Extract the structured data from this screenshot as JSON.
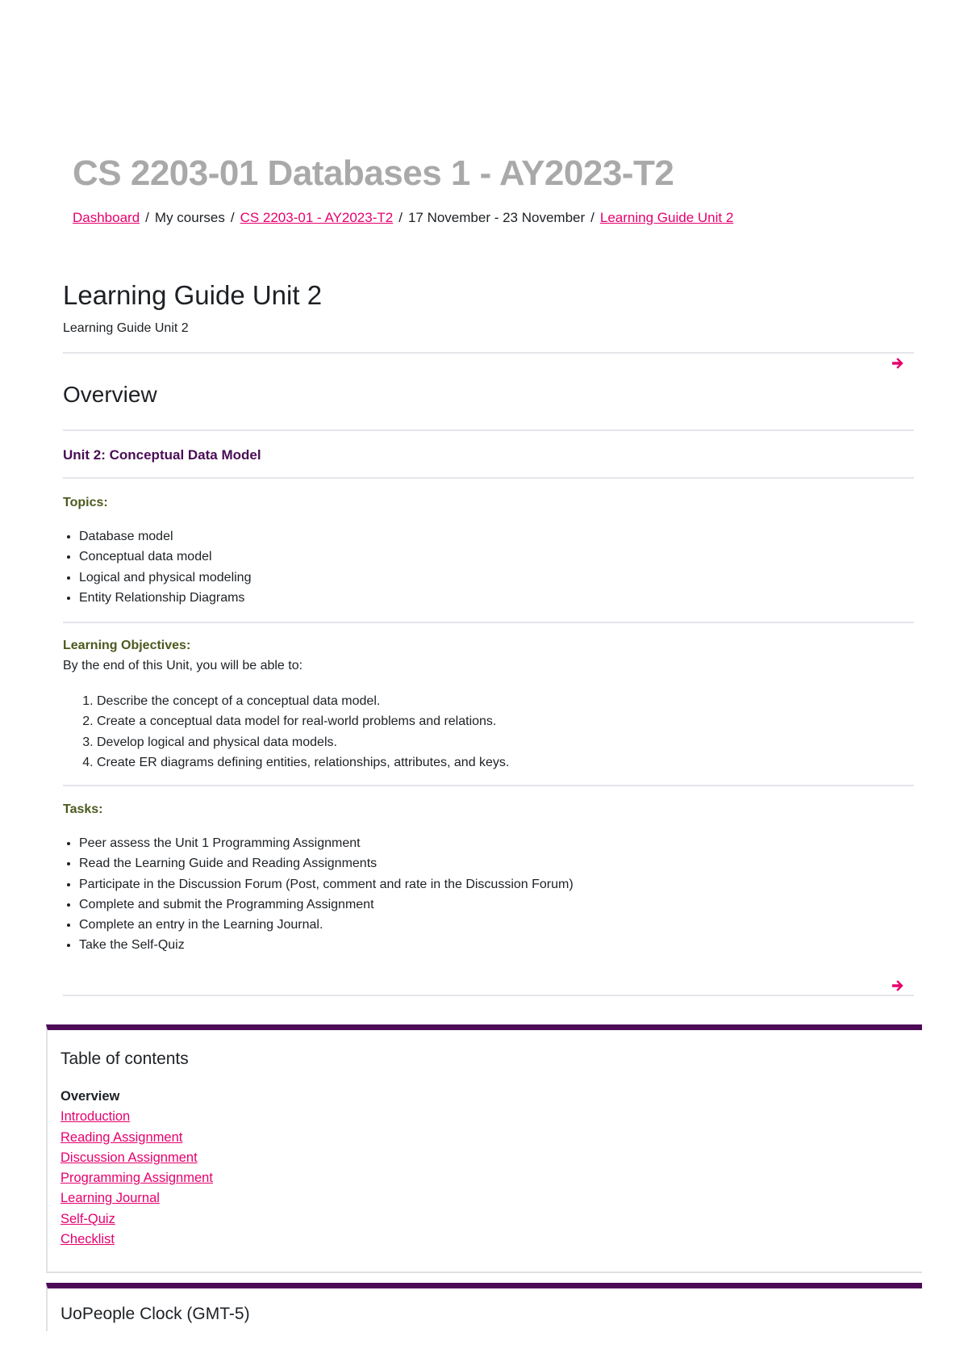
{
  "header": {
    "course_title": "CS 2203-01 Databases 1 - AY2023-T2",
    "breadcrumb": [
      {
        "label": "Dashboard",
        "link": true
      },
      {
        "label": "My courses",
        "link": false
      },
      {
        "label": "CS 2203-01 - AY2023-T2",
        "link": true
      },
      {
        "label": "17 November - 23 November",
        "link": false
      },
      {
        "label": "Learning Guide Unit 2",
        "link": true
      }
    ],
    "separator": "/"
  },
  "page": {
    "title": "Learning Guide Unit 2",
    "subtitle": "Learning Guide Unit 2",
    "next_icon": "arrow-right-icon"
  },
  "overview": {
    "title": "Overview",
    "unit_heading": "Unit 2: Conceptual Data Model",
    "topics_label": "Topics:",
    "topics": [
      "Database model",
      "Conceptual data model",
      "Logical and physical modeling",
      "Entity Relationship Diagrams"
    ],
    "objectives_label": "Learning Objectives:",
    "objectives_intro": "By the end of this Unit, you will be able to:",
    "objectives": [
      "Describe the concept of a conceptual data model.",
      "Create a conceptual data model for real-world problems and relations.",
      "Develop logical and physical data models.",
      "Create ER diagrams defining entities, relationships, attributes, and keys."
    ],
    "tasks_label": "Tasks:",
    "tasks": [
      "Peer assess the Unit 1 Programming Assignment",
      "Read the Learning Guide and Reading Assignments",
      "Participate in the Discussion Forum (Post, comment and rate in the Discussion Forum)",
      "Complete and submit the Programming Assignment",
      "Complete an entry in the Learning Journal.",
      "Take the Self-Quiz"
    ]
  },
  "toc": {
    "title": "Table of contents",
    "current": "Overview",
    "links": [
      "Introduction",
      "Reading Assignment",
      "Discussion Assignment",
      "Programming Assignment",
      "Learning Journal",
      "Self-Quiz",
      "Checklist"
    ]
  },
  "clock": {
    "title": "UoPeople Clock (GMT-5)"
  },
  "colors": {
    "link": "#e6006e",
    "accent_purple": "#4d0a57",
    "unit_heading": "#4a0e55",
    "section_label": "#4b5a1e",
    "course_title": "#a9a9a9"
  }
}
